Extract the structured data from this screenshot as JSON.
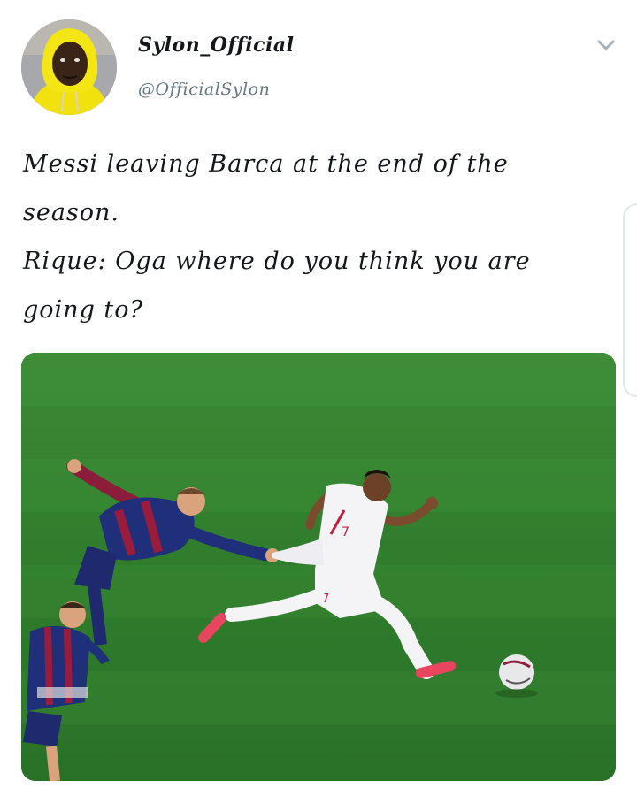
{
  "tweet": {
    "author": {
      "display_name": "Sylon_Official",
      "handle": "@OfficialSylon",
      "avatar_icon": "profile-photo-man-yellow-hoodie"
    },
    "menu_icon": "chevron-down-icon",
    "text_lines": [
      "Messi leaving Barca at the end of the",
      "season.",
      "Rique: Oga where do you think you are",
      "going to?"
    ],
    "media": {
      "description_icon": "football-match-photo",
      "pitch_color": "#2f7a2c"
    }
  }
}
